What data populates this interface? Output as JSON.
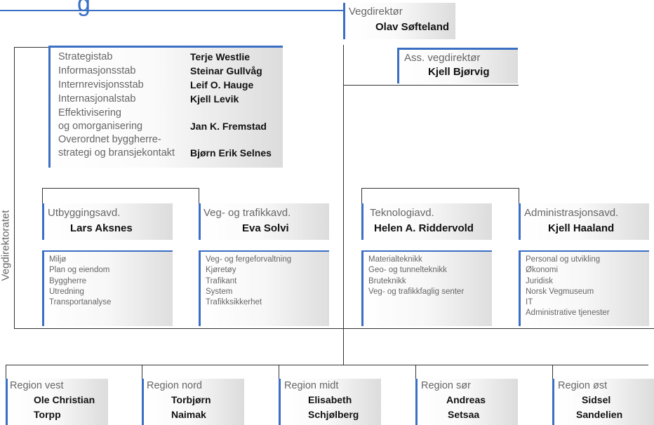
{
  "header": {
    "title_fragment": "g"
  },
  "side_label": "Vegdirektoratet",
  "director": {
    "unit": "Vegdirektør",
    "person": "Olav Søfteland"
  },
  "assistant": {
    "unit": "Ass. vegdirektør",
    "person": "Kjell Bjørvig"
  },
  "staff": [
    {
      "unit": "Strategistab",
      "person": "Terje Westlie"
    },
    {
      "unit": "Informasjonsstab",
      "person": "Steinar Gullvåg"
    },
    {
      "unit": "Internrevisjonsstab",
      "person": "Leif O. Hauge"
    },
    {
      "unit": "Internasjonalstab",
      "person": "Kjell Levik"
    },
    {
      "unit": "Effektivisering",
      "person": ""
    },
    {
      "unit": "og omorganisering",
      "person": "Jan K. Fremstad"
    },
    {
      "unit": "Overordnet byggherre-",
      "person": ""
    },
    {
      "unit": "strategi og bransjekontakt",
      "person": "Bjørn Erik Selnes"
    }
  ],
  "departments": [
    {
      "unit": "Utbyggingsavd.",
      "person": "Lars Aksnes",
      "items": [
        "Miljø",
        "Plan og eiendom",
        "Byggherre",
        "Utredning",
        "Transportanalyse"
      ]
    },
    {
      "unit": "Veg- og trafikkavd.",
      "person": "Eva Solvi",
      "items": [
        "Veg- og fergeforvaltning",
        "Kjøretøy",
        "Trafikant",
        "System",
        "Trafikksikkerhet"
      ]
    },
    {
      "unit": "Teknologiavd.",
      "person": "Helen A. Riddervold",
      "items": [
        "Materialteknikk",
        "Geo- og tunnelteknikk",
        "Bruteknikk",
        "Veg- og trafikkfaglig senter"
      ]
    },
    {
      "unit": "Administrasjonsavd.",
      "person": "Kjell Haaland",
      "items": [
        "Personal og utvikling",
        "Økonomi",
        "Juridisk",
        "Norsk Vegmuseum",
        "IT",
        "Administrative tjenester"
      ]
    }
  ],
  "regions": [
    {
      "unit": "Region vest",
      "person_line1": "Ole Christian",
      "person_line2": "Torpp"
    },
    {
      "unit": "Region nord",
      "person_line1": "Torbjørn",
      "person_line2": "Naimak"
    },
    {
      "unit": "Region midt",
      "person_line1": "Elisabeth",
      "person_line2": "Schjølberg"
    },
    {
      "unit": "Region sør",
      "person_line1": "Andreas",
      "person_line2": "Setsaa"
    },
    {
      "unit": "Region øst",
      "person_line1": "Sidsel",
      "person_line2": "Sandelien"
    }
  ],
  "colors": {
    "accent": "#3a6fc4",
    "line": "#333333",
    "box_shade": "#dcdcdc"
  }
}
